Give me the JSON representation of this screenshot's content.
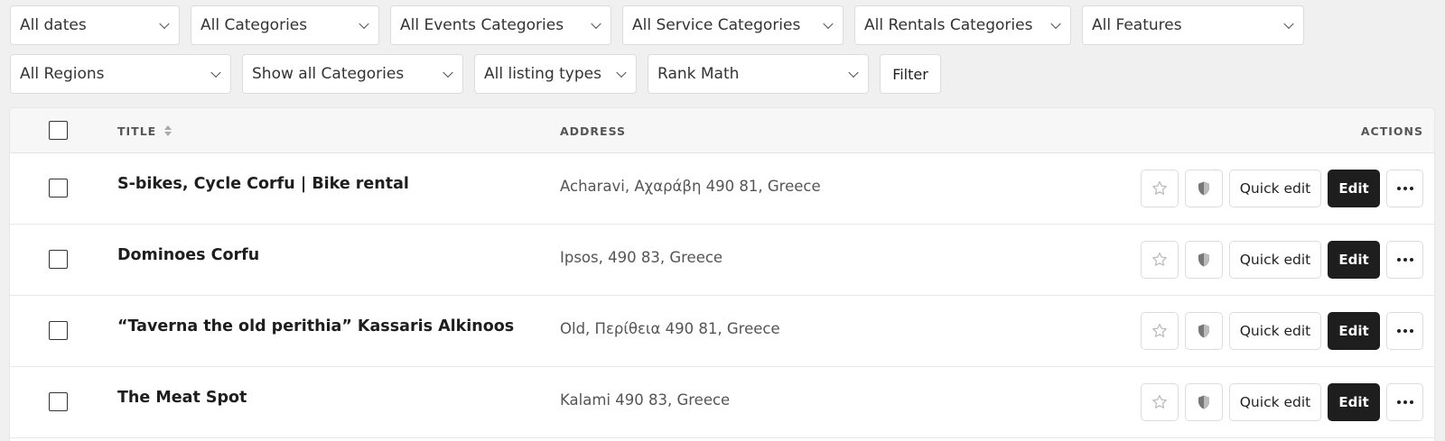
{
  "filters": {
    "row1": [
      "All dates",
      "All Categories",
      "All Events Categories",
      "All Service Categories",
      "All Rentals Categories",
      "All Features"
    ],
    "row2": [
      "All Regions",
      "Show all Categories",
      "All listing types",
      "Rank Math"
    ],
    "filter_button": "Filter"
  },
  "table": {
    "headers": {
      "title": "TITLE",
      "address": "ADDRESS",
      "actions": "ACTIONS"
    },
    "rows": [
      {
        "title": "S-bikes, Cycle Corfu | Bike rental",
        "address": "Acharavi, Αχαράβη 490 81, Greece"
      },
      {
        "title": "Dominoes Corfu",
        "address": "Ipsos, 490 83, Greece"
      },
      {
        "title": "“Taverna the old perithia” Kassaris Alkinoos",
        "address": "Old, Περίθεια 490 81, Greece"
      },
      {
        "title": "The Meat Spot",
        "address": "Kalami 490 83, Greece"
      }
    ],
    "actions": {
      "quick_edit": "Quick edit",
      "edit": "Edit"
    },
    "icons": {
      "star": "star-outline-icon",
      "shield": "shield-icon",
      "more": "more-horizontal-icon",
      "sort": "sort-icon"
    }
  }
}
